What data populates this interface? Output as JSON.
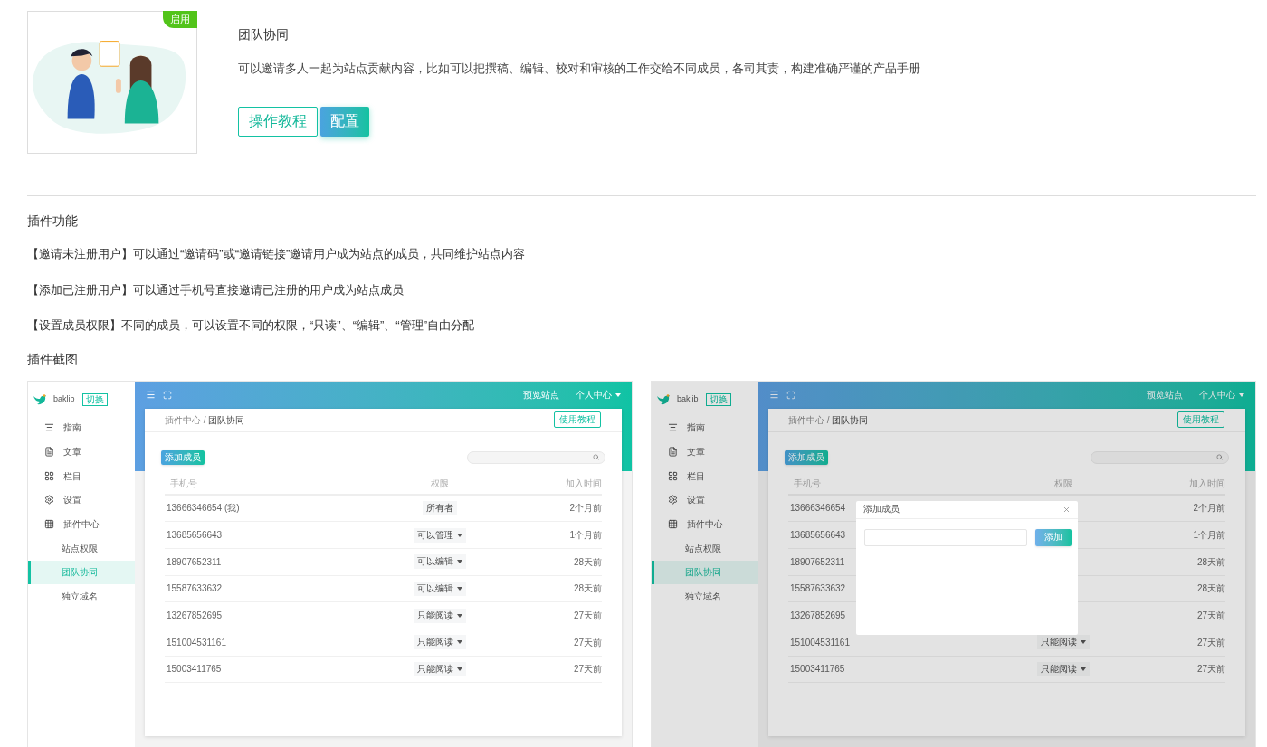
{
  "plugin": {
    "badge": "启用",
    "title": "团队协同",
    "description": "可以邀请多人一起为站点贡献内容，比如可以把撰稿、编辑、校对和审核的工作交给不同成员，各司其责，构建准确严谨的产品手册",
    "buttons": [
      {
        "label": "操作教程",
        "kind": "outline"
      },
      {
        "label": "配置",
        "kind": "primary"
      }
    ]
  },
  "features_title": "插件功能",
  "features": [
    "【邀请未注册用户】可以通过“邀请码”或“邀请链接”邀请用户成为站点的成员，共同维护站点内容",
    "【添加已注册用户】可以通过手机号直接邀请已注册的用户成为站点成员",
    "【设置成员权限】不同的成员，可以设置不同的权限，“只读”、“编辑”、“管理”自由分配"
  ],
  "screenshots_title": "插件截图",
  "screenshots": [
    {
      "dimmed": false,
      "logo": "baklib",
      "switch_label": "切换",
      "nav": [
        {
          "label": "指南",
          "selected": false
        },
        {
          "label": "文章",
          "selected": false
        },
        {
          "label": "栏目",
          "selected": false
        },
        {
          "label": "设置",
          "selected": false
        },
        {
          "label": "插件中心",
          "selected": false,
          "children": [
            {
              "label": "站点权限",
              "selected": false
            },
            {
              "label": "团队协同",
              "selected": true
            },
            {
              "label": "独立域名",
              "selected": false
            }
          ]
        }
      ],
      "top_links": [
        {
          "label": "预览站点",
          "dropdown": false
        },
        {
          "label": "个人中心",
          "dropdown": true
        }
      ],
      "breadcrumb": {
        "items": [
          "插件中心",
          "团队协同"
        ],
        "separator": "/"
      },
      "help_button": "使用教程",
      "add_button": "添加成员",
      "columns": [
        "手机号",
        "权限",
        "加入时间"
      ],
      "rows": [
        {
          "phone": "13666346654 (我)",
          "permission": "所有者",
          "dropdown": false,
          "joined": "2个月前"
        },
        {
          "phone": "13685656643",
          "permission": "可以管理",
          "dropdown": true,
          "joined": "1个月前"
        },
        {
          "phone": "18907652311",
          "permission": "可以编辑",
          "dropdown": true,
          "joined": "28天前"
        },
        {
          "phone": "15587633632",
          "permission": "可以编辑",
          "dropdown": true,
          "joined": "28天前"
        },
        {
          "phone": "13267852695",
          "permission": "只能阅读",
          "dropdown": true,
          "joined": "27天前"
        },
        {
          "phone": "151004531161",
          "permission": "只能阅读",
          "dropdown": true,
          "joined": "27天前"
        },
        {
          "phone": "15003411765",
          "permission": "只能阅读",
          "dropdown": true,
          "joined": "27天前"
        }
      ]
    },
    {
      "dimmed": true,
      "logo": "baklib",
      "switch_label": "切换",
      "nav": [
        {
          "label": "指南",
          "selected": false
        },
        {
          "label": "文章",
          "selected": false
        },
        {
          "label": "栏目",
          "selected": false
        },
        {
          "label": "设置",
          "selected": false
        },
        {
          "label": "插件中心",
          "selected": false,
          "children": [
            {
              "label": "站点权限",
              "selected": false
            },
            {
              "label": "团队协同",
              "selected": true
            },
            {
              "label": "独立域名",
              "selected": false
            }
          ]
        }
      ],
      "top_links": [
        {
          "label": "预览站点",
          "dropdown": false
        },
        {
          "label": "个人中心",
          "dropdown": true
        }
      ],
      "breadcrumb": {
        "items": [
          "插件中心",
          "团队协同"
        ],
        "separator": "/"
      },
      "help_button": "使用教程",
      "add_button": "添加成员",
      "columns": [
        "手机号",
        "权限",
        "加入时间"
      ],
      "rows": [
        {
          "phone": "13666346654",
          "joined": "2个月前"
        },
        {
          "phone": "13685656643",
          "joined": "1个月前"
        },
        {
          "phone": "18907652311",
          "joined": "28天前"
        },
        {
          "phone": "15587633632",
          "joined": "28天前"
        },
        {
          "phone": "13267852695",
          "joined": "27天前"
        },
        {
          "phone": "151004531161",
          "permission": "只能阅读",
          "dropdown": true,
          "joined": "27天前"
        },
        {
          "phone": "15003411765",
          "permission": "只能阅读",
          "dropdown": true,
          "joined": "27天前"
        }
      ],
      "modal": {
        "title": "添加成员",
        "button": "添加"
      }
    }
  ]
}
